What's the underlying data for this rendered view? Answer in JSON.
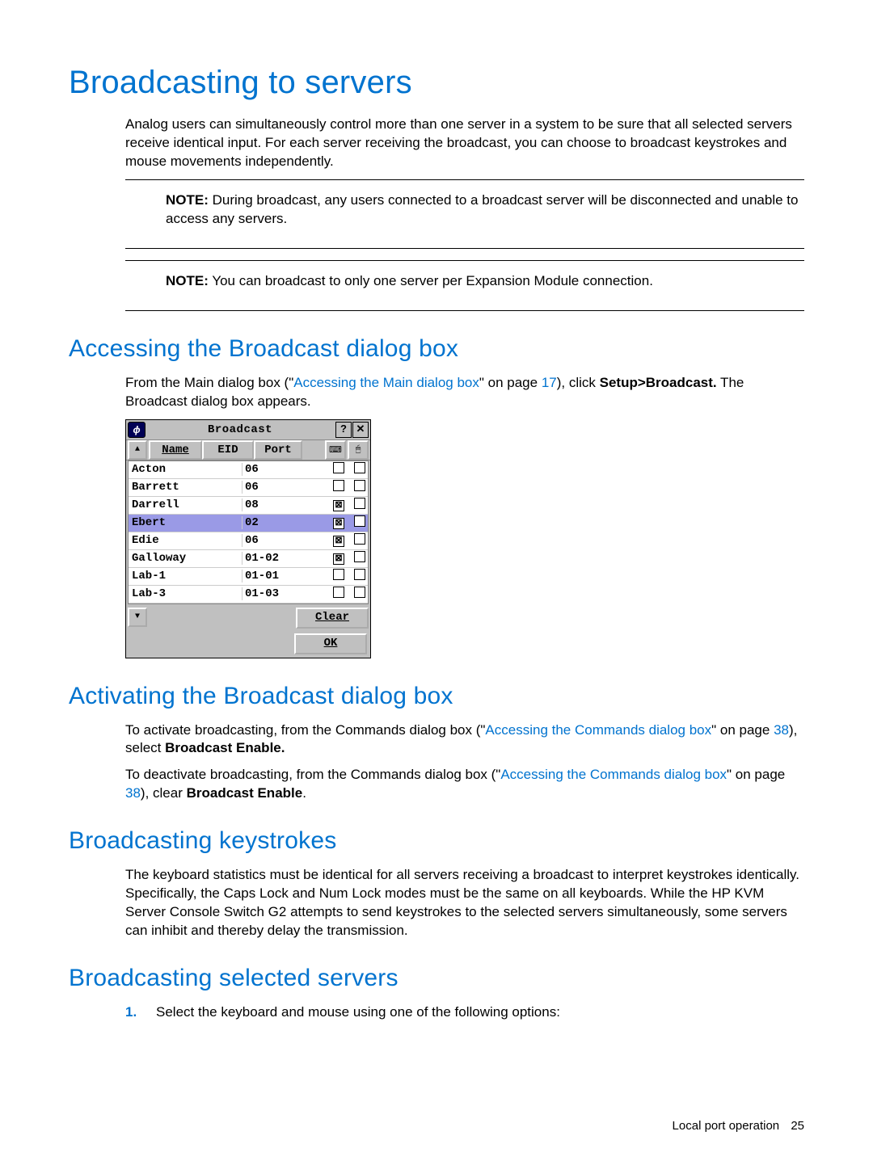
{
  "h1": "Broadcasting to servers",
  "intro": "Analog users can simultaneously control more than one server in a system to be sure that all selected servers receive identical input. For each server receiving the broadcast, you can choose to broadcast keystrokes and mouse movements independently.",
  "note1_label": "NOTE:",
  "note1": "During broadcast, any users connected to a broadcast server will be disconnected and unable to access any servers.",
  "note2_label": "NOTE:",
  "note2": "You can broadcast to only one server per Expansion Module connection.",
  "h2a": "Accessing the Broadcast dialog box",
  "access_p1a": "From the Main dialog box (\"",
  "access_link1": "Accessing the Main dialog box",
  "access_p1b": "\" on page ",
  "access_page1": "17",
  "access_p1c": "), click ",
  "access_bold1": "Setup>Broadcast.",
  "access_p1d": " The Broadcast dialog box appears.",
  "dialog": {
    "title": "Broadcast",
    "headers": {
      "name": "Name",
      "eid": "EID",
      "port": "Port"
    },
    "rows": [
      {
        "name": "Acton",
        "eid": "",
        "port": "06",
        "kb": false,
        "ms": false,
        "sel": false
      },
      {
        "name": "Barrett",
        "eid": "",
        "port": "06",
        "kb": false,
        "ms": false,
        "sel": false
      },
      {
        "name": "Darrell",
        "eid": "",
        "port": "08",
        "kb": true,
        "ms": false,
        "sel": false
      },
      {
        "name": "Ebert",
        "eid": "",
        "port": "02",
        "kb": true,
        "ms": false,
        "sel": true
      },
      {
        "name": "Edie",
        "eid": "",
        "port": "06",
        "kb": true,
        "ms": false,
        "sel": false
      },
      {
        "name": "Galloway",
        "eid": "",
        "port": "01-02",
        "kb": true,
        "ms": false,
        "sel": false
      },
      {
        "name": "Lab-1",
        "eid": "",
        "port": "01-01",
        "kb": false,
        "ms": false,
        "sel": false
      },
      {
        "name": "Lab-3",
        "eid": "",
        "port": "01-03",
        "kb": false,
        "ms": false,
        "sel": false
      }
    ],
    "clear_btn": "Clear",
    "ok_btn": "OK"
  },
  "h2b": "Activating the Broadcast dialog box",
  "act_p1a": "To activate broadcasting, from the Commands dialog box (\"",
  "act_link1": "Accessing the Commands dialog box",
  "act_p1b": "\" on page ",
  "act_page1": "38",
  "act_p1c": "), select ",
  "act_bold1": "Broadcast Enable.",
  "act_p2a": "To deactivate broadcasting, from the Commands dialog box (\"",
  "act_link2": "Accessing the Commands dialog box",
  "act_p2b": "\" on page ",
  "act_page2": "38",
  "act_p2c": "), clear ",
  "act_bold2": "Broadcast Enable",
  "act_p2d": ".",
  "h2c": "Broadcasting keystrokes",
  "keys_p": "The keyboard statistics must be identical for all servers receiving a broadcast to interpret keystrokes identically. Specifically, the Caps Lock and Num Lock modes must be the same on all keyboards. While the HP KVM Server Console Switch G2 attempts to send keystrokes to the selected servers simultaneously, some servers can inhibit and thereby delay the transmission.",
  "h2d": "Broadcasting selected servers",
  "sel_step1_num": "1.",
  "sel_step1": "Select the keyboard and mouse using one of the following options:",
  "footer_section": "Local port operation",
  "footer_page": "25"
}
